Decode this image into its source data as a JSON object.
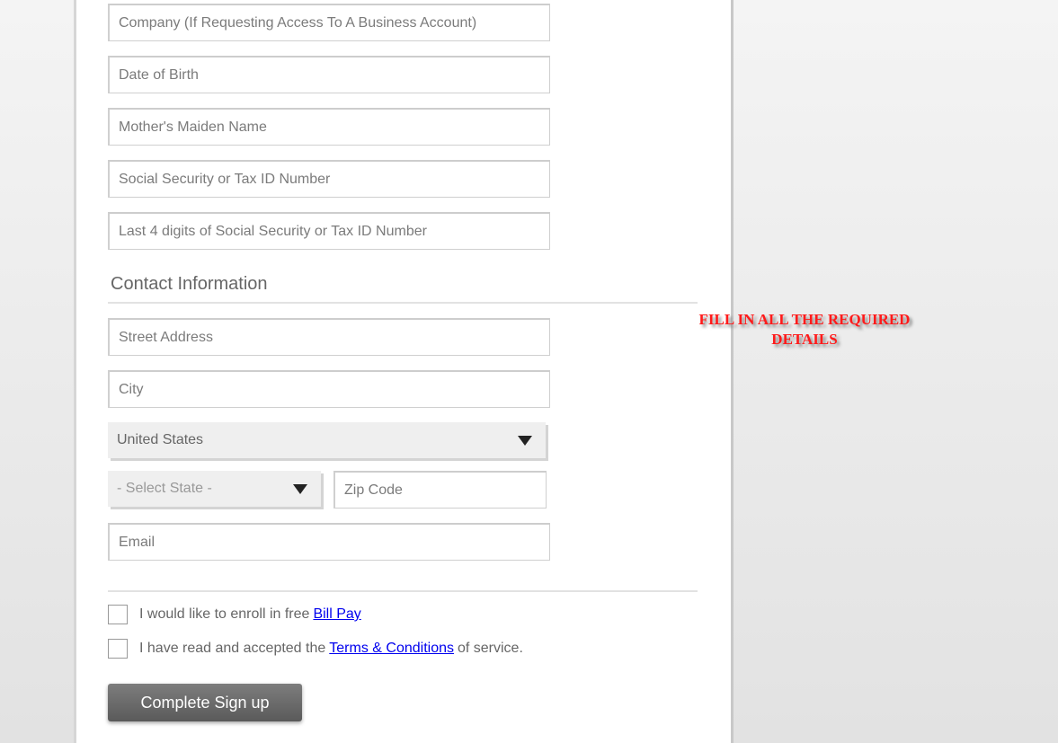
{
  "form": {
    "identity_fields": [
      {
        "placeholder": "Company (If Requesting Access To A Business Account)",
        "value": ""
      },
      {
        "placeholder": "Date of Birth",
        "value": ""
      },
      {
        "placeholder": "Mother's Maiden Name",
        "value": ""
      },
      {
        "placeholder": "Social Security or Tax ID Number",
        "value": ""
      },
      {
        "placeholder": "Last 4 digits of Social Security or Tax ID Number",
        "value": ""
      }
    ],
    "contact_section_title": "Contact Information",
    "street_address": {
      "placeholder": "Street Address",
      "value": ""
    },
    "city": {
      "placeholder": "City",
      "value": ""
    },
    "country_select": {
      "selected": "United States"
    },
    "state_select": {
      "selected": "- Select State -"
    },
    "zip_code": {
      "placeholder": "Zip Code",
      "value": ""
    },
    "email": {
      "placeholder": "Email",
      "value": ""
    },
    "bill_pay": {
      "checked": false,
      "text_before": "I would like to enroll in free",
      "link_text": "Bill Pay"
    },
    "terms": {
      "checked": false,
      "text_before": "I have read and accepted the",
      "link_text": "Terms & Conditions",
      "text_after": "of service."
    },
    "submit_label": "Complete Sign up"
  },
  "annotation": {
    "line1": "FILL IN ALL THE REQUIRED",
    "line2": "DETAILS",
    "color": "#ff1a1a"
  },
  "icons": {
    "dropdown": "chevron-down-icon (solid triangle)",
    "checkbox": "empty-checkbox"
  }
}
